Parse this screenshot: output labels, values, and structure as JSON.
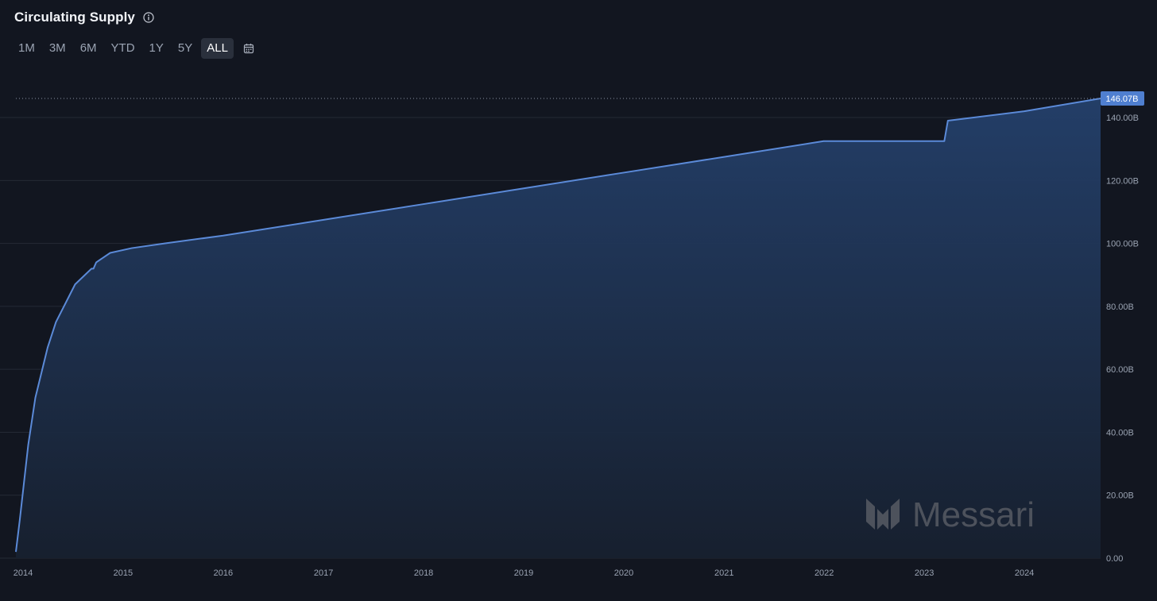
{
  "header": {
    "title": "Circulating Supply"
  },
  "ranges": [
    {
      "label": "1M",
      "active": false
    },
    {
      "label": "3M",
      "active": false
    },
    {
      "label": "6M",
      "active": false
    },
    {
      "label": "YTD",
      "active": false
    },
    {
      "label": "1Y",
      "active": false
    },
    {
      "label": "5Y",
      "active": false
    },
    {
      "label": "ALL",
      "active": true
    }
  ],
  "watermark": "Messari",
  "colors": {
    "line": "#5b8ad8",
    "area_top": "#24406b",
    "area_bottom": "#17202f",
    "grid": "#242a35",
    "background": "#121620",
    "label_bg": "#4f7fd0"
  },
  "icons": {
    "info": "info-circle-icon",
    "calendar": "calendar-icon",
    "logo": "messari-logo-icon"
  },
  "chart_data": {
    "type": "area",
    "title": "Circulating Supply",
    "unit": "B",
    "xlim": [
      "2013-12-06",
      "2024-10-05"
    ],
    "ylim": [
      0,
      146.07
    ],
    "y_ticks": [
      0,
      20,
      40,
      60,
      80,
      100,
      120,
      140
    ],
    "y_tick_labels": [
      "0.00",
      "20.00B",
      "40.00B",
      "60.00B",
      "80.00B",
      "100.00B",
      "120.00B",
      "140.00B"
    ],
    "x_ticks": [
      "2014-01-01",
      "2015-01-01",
      "2016-01-01",
      "2017-01-01",
      "2018-01-01",
      "2019-01-01",
      "2020-01-01",
      "2021-01-01",
      "2022-01-01",
      "2023-01-01",
      "2024-01-01"
    ],
    "x_tick_labels": [
      "2014",
      "2015",
      "2016",
      "2017",
      "2018",
      "2019",
      "2020",
      "2021",
      "2022",
      "2023",
      "2024"
    ],
    "last_value_label": "146.07B",
    "grid": true,
    "series": [
      {
        "x": [
          "2013-12-06",
          "2013-12-20",
          "2014-01-20",
          "2014-02-15",
          "2014-04-01",
          "2014-05-01",
          "2014-07-10",
          "2014-08-15",
          "2014-09-08",
          "2014-09-15",
          "2014-09-25",
          "2014-11-15",
          "2015-02-01",
          "2015-06-01",
          "2016-01-01",
          "2017-01-01",
          "2018-01-01",
          "2019-01-01",
          "2020-01-01",
          "2021-01-01",
          "2021-12-30",
          "2023-03-15",
          "2023-03-28",
          "2024-01-01",
          "2024-10-05"
        ],
        "y": [
          2,
          12,
          36,
          51,
          67,
          75,
          87,
          90,
          92,
          92,
          94,
          97,
          98.5,
          100,
          102.5,
          107.5,
          112.5,
          117.5,
          122.5,
          127.5,
          132.5,
          132.5,
          139,
          142,
          146.07
        ]
      }
    ]
  }
}
